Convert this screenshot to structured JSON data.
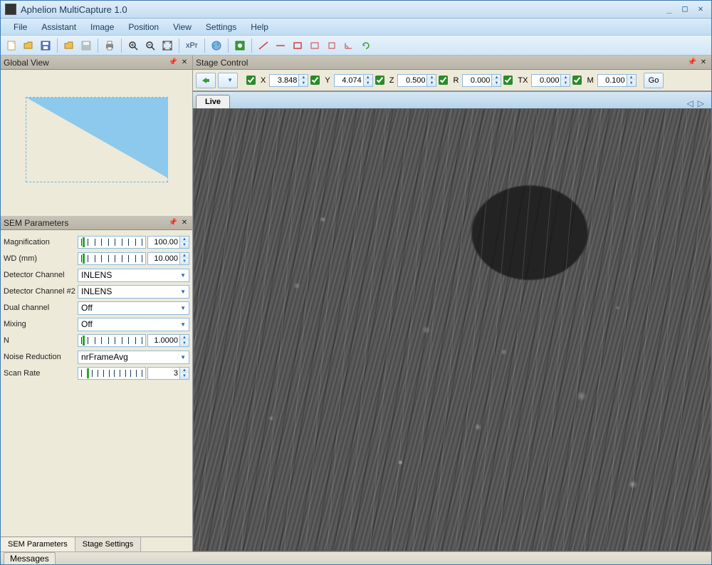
{
  "app": {
    "title": "Aphelion MultiCapture 1.0"
  },
  "menu": {
    "file": "File",
    "assistant": "Assistant",
    "image": "Image",
    "position": "Position",
    "view": "View",
    "settings": "Settings",
    "help": "Help"
  },
  "toolbar": {
    "xpr": "xPr"
  },
  "panels": {
    "global_view": {
      "title": "Global View"
    },
    "sem_params": {
      "title": "SEM Parameters",
      "fields": {
        "magnification": {
          "label": "Magnification",
          "value": "100.00"
        },
        "wd": {
          "label": "WD (mm)",
          "value": "10.000"
        },
        "detector": {
          "label": "Detector Channel",
          "value": "INLENS"
        },
        "detector2": {
          "label": "Detector Channel #2",
          "value": "INLENS"
        },
        "dual": {
          "label": "Dual channel",
          "value": "Off"
        },
        "mixing": {
          "label": "Mixing",
          "value": "Off"
        },
        "n": {
          "label": "N",
          "value": "1.0000"
        },
        "noise": {
          "label": "Noise Reduction",
          "value": "nrFrameAvg"
        },
        "scan": {
          "label": "Scan Rate",
          "value": "3"
        }
      }
    },
    "stage_control": {
      "title": "Stage Control"
    }
  },
  "tabs": {
    "sem_params": "SEM Parameters",
    "stage_settings": "Stage Settings",
    "messages": "Messages",
    "live": "Live"
  },
  "stage": {
    "x": {
      "label": "X",
      "value": "3.848"
    },
    "y": {
      "label": "Y",
      "value": "4.074"
    },
    "z": {
      "label": "Z",
      "value": "0.500"
    },
    "r": {
      "label": "R",
      "value": "0.000"
    },
    "tx": {
      "label": "TX",
      "value": "0.000"
    },
    "m": {
      "label": "M",
      "value": "0.100"
    },
    "go": "Go"
  }
}
